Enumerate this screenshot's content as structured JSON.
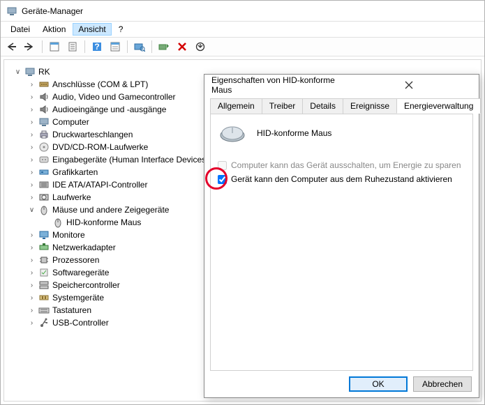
{
  "window": {
    "title": "Geräte-Manager"
  },
  "menubar": {
    "items": [
      "Datei",
      "Aktion",
      "Ansicht",
      "?"
    ],
    "activeIndex": 2
  },
  "toolbar": {
    "names": [
      "back",
      "forward",
      "show-hidden",
      "properties",
      "help",
      "prop-sheet",
      "scan-hw",
      "monitor",
      "update-drv",
      "remove",
      "refresh"
    ]
  },
  "tree": {
    "root": {
      "label": "RK"
    },
    "nodes": [
      {
        "icon": "port",
        "label": "Anschlüsse (COM & LPT)"
      },
      {
        "icon": "audio",
        "label": "Audio, Video und Gamecontroller"
      },
      {
        "icon": "audio",
        "label": "Audioeingänge und -ausgänge"
      },
      {
        "icon": "computer",
        "label": "Computer"
      },
      {
        "icon": "printer",
        "label": "Druckwarteschlangen"
      },
      {
        "icon": "disc",
        "label": "DVD/CD-ROM-Laufwerke"
      },
      {
        "icon": "hid",
        "label": "Eingabegeräte (Human Interface Devices)"
      },
      {
        "icon": "gpu",
        "label": "Grafikkarten"
      },
      {
        "icon": "ide",
        "label": "IDE ATA/ATAPI-Controller"
      },
      {
        "icon": "disk",
        "label": "Laufwerke"
      },
      {
        "icon": "mouse",
        "label": "Mäuse und andere Zeigegeräte",
        "expanded": true,
        "children": [
          {
            "icon": "mouse",
            "label": "HID-konforme Maus"
          }
        ]
      },
      {
        "icon": "monitor",
        "label": "Monitore"
      },
      {
        "icon": "net",
        "label": "Netzwerkadapter"
      },
      {
        "icon": "cpu",
        "label": "Prozessoren"
      },
      {
        "icon": "soft",
        "label": "Softwaregeräte"
      },
      {
        "icon": "storage",
        "label": "Speichercontroller"
      },
      {
        "icon": "system",
        "label": "Systemgeräte"
      },
      {
        "icon": "keyboard",
        "label": "Tastaturen"
      },
      {
        "icon": "usb",
        "label": "USB-Controller"
      }
    ]
  },
  "dialog": {
    "title": "Eigenschaften von HID-konforme Maus",
    "tabs": [
      "Allgemein",
      "Treiber",
      "Details",
      "Ereignisse",
      "Energieverwaltung"
    ],
    "activeTab": 4,
    "deviceName": "HID-konforme Maus",
    "checkbox1": {
      "label": "Computer kann das Gerät ausschalten, um Energie zu sparen",
      "checked": false,
      "enabled": false
    },
    "checkbox2": {
      "label": "Gerät kann den Computer aus dem Ruhezustand aktivieren",
      "checked": true,
      "enabled": true
    },
    "buttons": {
      "ok": "OK",
      "cancel": "Abbrechen"
    }
  }
}
